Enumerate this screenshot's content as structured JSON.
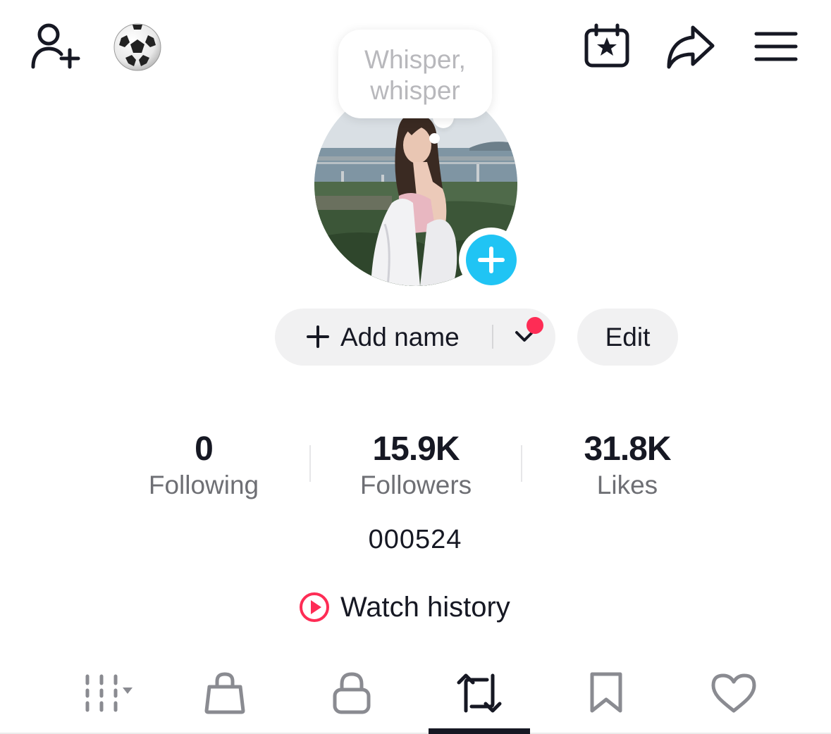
{
  "top_bar": {
    "icons": [
      "add-friend-icon",
      "soccer-ball-icon",
      "calendar-star-icon",
      "share-icon",
      "menu-icon"
    ]
  },
  "profile": {
    "thought_bubble": "Whisper, whisper",
    "add_name_label": "Add name",
    "edit_label": "Edit"
  },
  "stats": [
    {
      "value": "0",
      "label": "Following"
    },
    {
      "value": "15.9K",
      "label": "Followers"
    },
    {
      "value": "31.8K",
      "label": "Likes"
    }
  ],
  "bio": "000524",
  "watch_history_label": "Watch history",
  "tabs": [
    "videos-grid-icon",
    "shop-bag-icon",
    "private-lock-icon",
    "reposts-icon",
    "favorites-bookmark-icon",
    "liked-heart-icon"
  ],
  "active_tab": "reposts-icon",
  "colors": {
    "accent_blue": "#20c4f4",
    "accent_red": "#fe2c55",
    "text_primary": "#161823",
    "text_secondary": "#6e6f74",
    "pill_bg": "#f1f1f2"
  }
}
